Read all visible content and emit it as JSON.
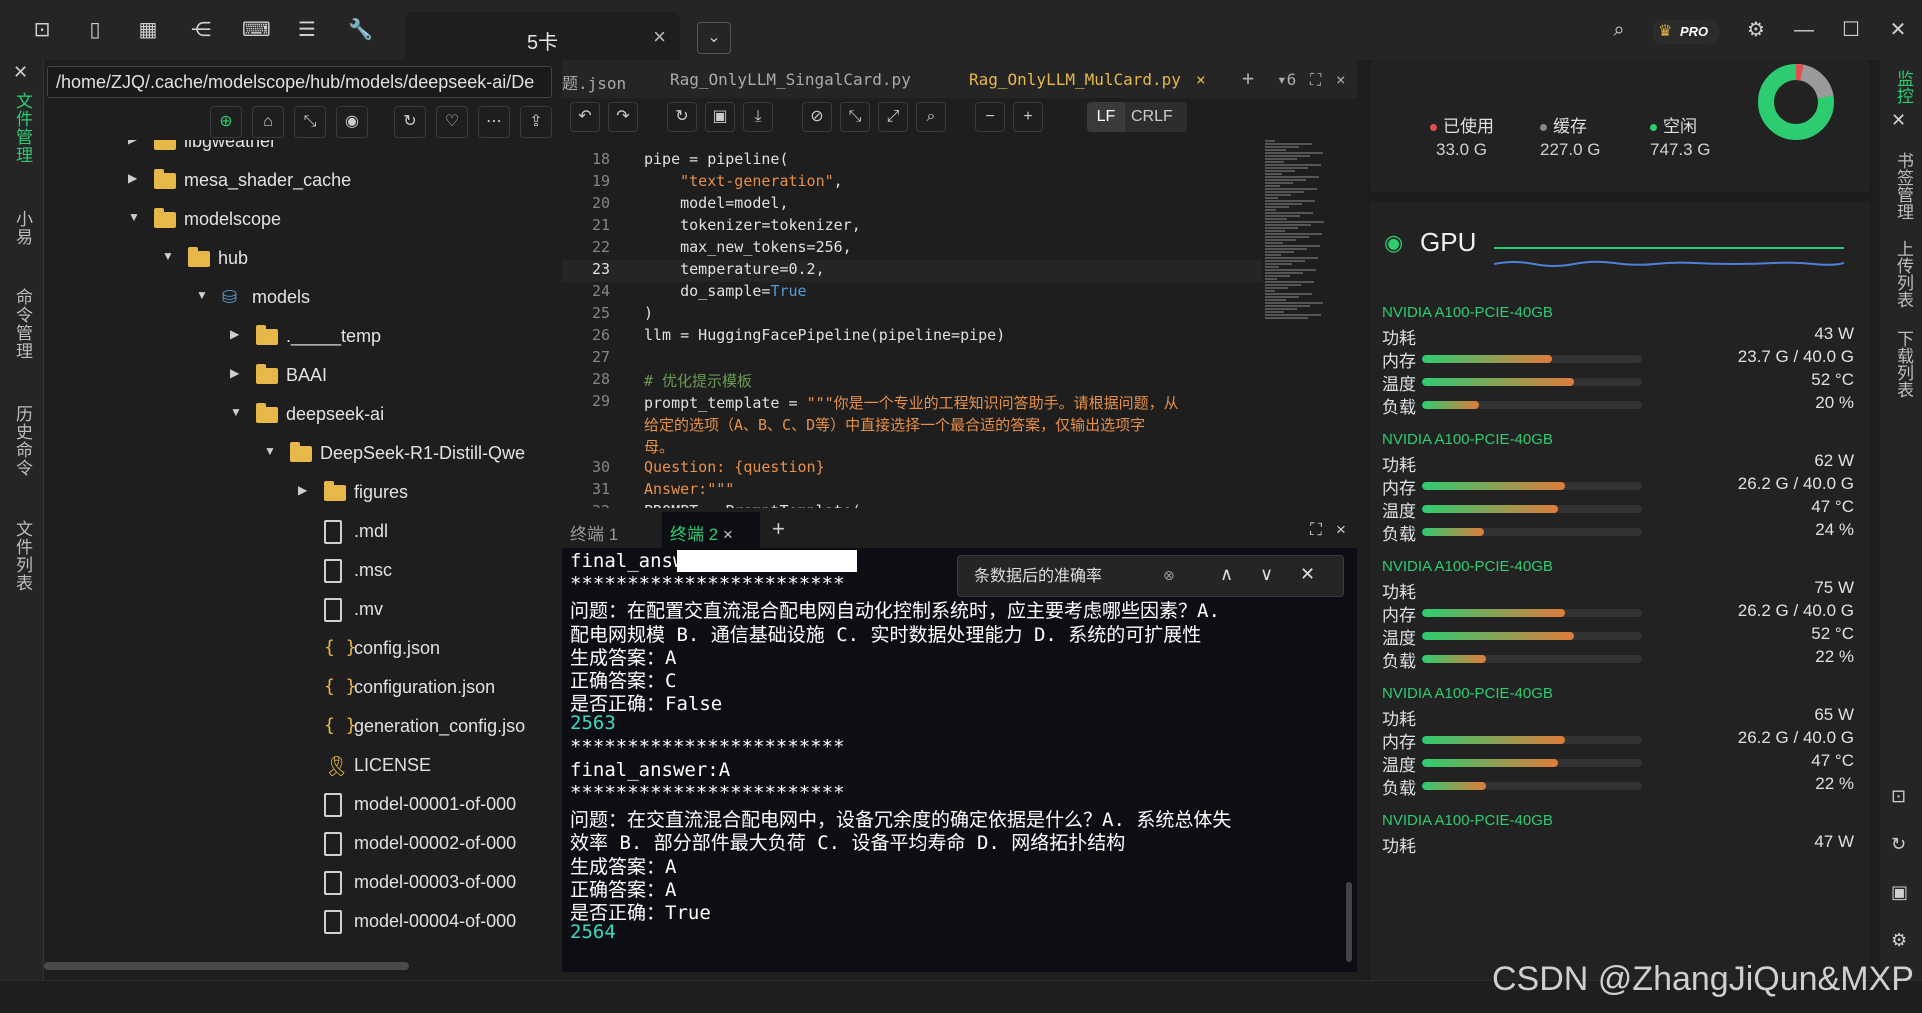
{
  "window": {
    "active_tab": "5卡",
    "pro_label": "PRO"
  },
  "left_rail": [
    "文件管理",
    "小易",
    "命令管理",
    "历史命令",
    "文件列表"
  ],
  "file_panel": {
    "path": "/home/ZJQ/.cache/modelscope/hub/models/deepseek-ai/De",
    "tree": [
      {
        "label": "libgweather",
        "depth": 0,
        "type": "folder",
        "caret": "right"
      },
      {
        "label": "mesa_shader_cache",
        "depth": 0,
        "type": "folder",
        "caret": "right"
      },
      {
        "label": "modelscope",
        "depth": 0,
        "type": "folder",
        "caret": "down"
      },
      {
        "label": "hub",
        "depth": 1,
        "type": "folder",
        "caret": "down"
      },
      {
        "label": "models",
        "depth": 2,
        "type": "models",
        "caret": "down"
      },
      {
        "label": "._____temp",
        "depth": 3,
        "type": "folder",
        "caret": "right"
      },
      {
        "label": "BAAI",
        "depth": 3,
        "type": "folder",
        "caret": "right"
      },
      {
        "label": "deepseek-ai",
        "depth": 3,
        "type": "folder",
        "caret": "down"
      },
      {
        "label": "DeepSeek-R1-Distill-Qwe",
        "depth": 4,
        "type": "folder",
        "caret": "down"
      },
      {
        "label": "figures",
        "depth": 5,
        "type": "folder",
        "caret": "right"
      },
      {
        "label": ".mdl",
        "depth": 5,
        "type": "file",
        "caret": ""
      },
      {
        "label": ".msc",
        "depth": 5,
        "type": "file",
        "caret": ""
      },
      {
        "label": ".mv",
        "depth": 5,
        "type": "file",
        "caret": ""
      },
      {
        "label": "config.json",
        "depth": 5,
        "type": "json",
        "caret": ""
      },
      {
        "label": "configuration.json",
        "depth": 5,
        "type": "json",
        "caret": ""
      },
      {
        "label": "generation_config.jso",
        "depth": 5,
        "type": "json",
        "caret": ""
      },
      {
        "label": "LICENSE",
        "depth": 5,
        "type": "license",
        "caret": ""
      },
      {
        "label": "model-00001-of-000",
        "depth": 5,
        "type": "file",
        "caret": ""
      },
      {
        "label": "model-00002-of-000",
        "depth": 5,
        "type": "file",
        "caret": ""
      },
      {
        "label": "model-00003-of-000",
        "depth": 5,
        "type": "file",
        "caret": ""
      },
      {
        "label": "model-00004-of-000",
        "depth": 5,
        "type": "file",
        "caret": ""
      }
    ]
  },
  "editor": {
    "tabs": [
      "题.json",
      "Rag_OnlyLLM_SingalCard.py",
      "Rag_OnlyLLM_MulCard.py"
    ],
    "more_tabs": "6",
    "eol": {
      "lf": "LF",
      "crlf": "CRLF"
    },
    "lines": [
      {
        "n": "18",
        "html": "pipe = pipeline("
      },
      {
        "n": "19",
        "html": "    <span class=\"s\">\"text-generation\"</span>,"
      },
      {
        "n": "20",
        "html": "    model=model,"
      },
      {
        "n": "21",
        "html": "    tokenizer=tokenizer,"
      },
      {
        "n": "22",
        "html": "    max_new_tokens=256,"
      },
      {
        "n": "23",
        "html": "    temperature=0.2,"
      },
      {
        "n": "24",
        "html": "    do_sample=<span class=\"kw\">True</span>"
      },
      {
        "n": "25",
        "html": ")"
      },
      {
        "n": "26",
        "html": "llm = HuggingFacePipeline(pipeline=pipe)"
      },
      {
        "n": "27",
        "html": ""
      },
      {
        "n": "28",
        "html": "<span class=\"cm\"># 优化提示模板</span>"
      },
      {
        "n": "29",
        "html": "prompt_template = <span class=\"s\">\"\"\"你是一个专业的工程知识问答助手。请根据问题，从</span>"
      },
      {
        "n": "",
        "html": "<span class=\"s\">给定的选项（A、B、C、D等）中直接选择一个最合适的答案，仅输出选项字</span>"
      },
      {
        "n": "",
        "html": "<span class=\"s\">母。</span>"
      },
      {
        "n": "30",
        "html": "<span class=\"s\">Question: {question}</span>"
      },
      {
        "n": "31",
        "html": "<span class=\"s\">Answer:\"\"\"</span>"
      },
      {
        "n": "32",
        "html": "PROMPT = PromptTemplate("
      }
    ]
  },
  "terminal": {
    "tabs": [
      {
        "label": "终端",
        "num": "1"
      },
      {
        "label": "终端",
        "num": "2"
      }
    ],
    "find_text": "条数据后的准确率",
    "lines": [
      {
        "t": "final_answ",
        "c": ""
      },
      {
        "t": "************************",
        "c": ""
      },
      {
        "t": "问题：在配置交直流混合配电网自动化控制系统时，应主要考虑哪些因素？A.",
        "c": ""
      },
      {
        "t": "配电网规模 B. 通信基础设施 C. 实时数据处理能力 D. 系统的可扩展性",
        "c": ""
      },
      {
        "t": "生成答案：A",
        "c": ""
      },
      {
        "t": "正确答案：C",
        "c": ""
      },
      {
        "t": "是否正确：False",
        "c": ""
      },
      {
        "t": "2563",
        "c": "cy"
      },
      {
        "t": "************************",
        "c": ""
      },
      {
        "t": "final_answer:A",
        "c": ""
      },
      {
        "t": "************************",
        "c": ""
      },
      {
        "t": "问题：在交直流混合配电网中，设备冗余度的确定依据是什么？A. 系统总体失",
        "c": ""
      },
      {
        "t": "效率 B. 部分部件最大负荷 C. 设备平均寿命 D. 网络拓扑结构",
        "c": ""
      },
      {
        "t": "生成答案：A",
        "c": ""
      },
      {
        "t": "正确答案：A",
        "c": ""
      },
      {
        "t": "是否正确：True",
        "c": ""
      },
      {
        "t": "2564",
        "c": "cy"
      }
    ]
  },
  "memory": {
    "used_label": "已使用",
    "used_value": "33.0 G",
    "cache_label": "缓存",
    "cache_value": "227.0 G",
    "free_label": "空闲",
    "free_value": "747.3 G",
    "used_fraction": 0.033
  },
  "gpu": {
    "title": "GPU",
    "keys": {
      "power": "功耗",
      "mem": "内存",
      "temp": "温度",
      "load": "负载"
    },
    "cards": [
      {
        "name": "NVIDIA A100-PCIE-40GB",
        "power": "43 W",
        "mem": "23.7 G / 40.0 G",
        "mem_frac": 0.59,
        "temp": "52 °C",
        "temp_frac": 0.69,
        "load": "20 %",
        "load_frac": 0.26
      },
      {
        "name": "NVIDIA A100-PCIE-40GB",
        "power": "62 W",
        "mem": "26.2 G / 40.0 G",
        "mem_frac": 0.65,
        "temp": "47 °C",
        "temp_frac": 0.62,
        "load": "24 %",
        "load_frac": 0.28
      },
      {
        "name": "NVIDIA A100-PCIE-40GB",
        "power": "75 W",
        "mem": "26.2 G / 40.0 G",
        "mem_frac": 0.65,
        "temp": "52 °C",
        "temp_frac": 0.69,
        "load": "22 %",
        "load_frac": 0.29
      },
      {
        "name": "NVIDIA A100-PCIE-40GB",
        "power": "65 W",
        "mem": "26.2 G / 40.0 G",
        "mem_frac": 0.65,
        "temp": "47 °C",
        "temp_frac": 0.62,
        "load": "22 %",
        "load_frac": 0.29
      },
      {
        "name": "NVIDIA A100-PCIE-40GB",
        "power": "47 W"
      }
    ]
  },
  "right_rail": [
    "监控",
    "书签管理",
    "上传列表",
    "下载列表"
  ],
  "watermark": "CSDN @ZhangJiQun&MXP",
  "colors": {
    "accent": "#2ecc71",
    "folder": "#e6b84a",
    "tab_active": "#e6b84a"
  }
}
